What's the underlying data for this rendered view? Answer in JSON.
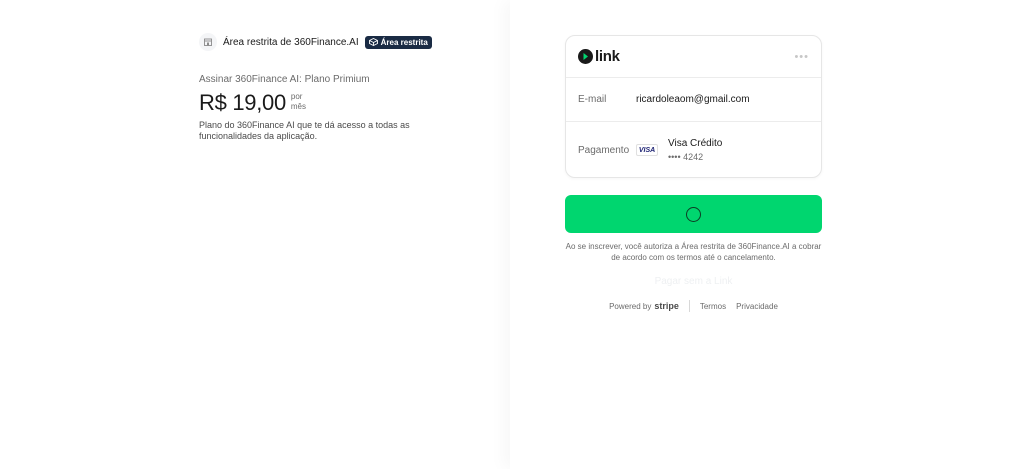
{
  "merchant": {
    "name": "Área restrita de 360Finance.AI",
    "badge": "Área restrita",
    "icon": "store-icon"
  },
  "product": {
    "name": "Assinar 360Finance AI: Plano Primium",
    "price": "R$ 19,00",
    "per_line1": "por",
    "per_line2": "mês",
    "description": "Plano do 360Finance AI que te dá acesso a todas as funcionalidades da aplicação."
  },
  "link_card": {
    "brand": "link",
    "email_label": "E-mail",
    "email_value": "ricardoleaom@gmail.com",
    "payment_label": "Pagamento",
    "card_brand": "VISA",
    "card_name": "Visa Crédito",
    "card_digits": "•••• 4242"
  },
  "pay_button": {
    "state": "loading"
  },
  "terms": "Ao se inscrever, você autoriza a Área restrita de 360Finance.AI a cobrar de acordo com os termos até o cancelamento.",
  "pay_without_link": "Pagar sem a Link",
  "footer": {
    "powered_by": "Powered by",
    "stripe": "stripe",
    "terms": "Termos",
    "privacy": "Privacidade"
  },
  "colors": {
    "accent_green": "#00d66f",
    "badge_navy": "#1a2b44"
  }
}
